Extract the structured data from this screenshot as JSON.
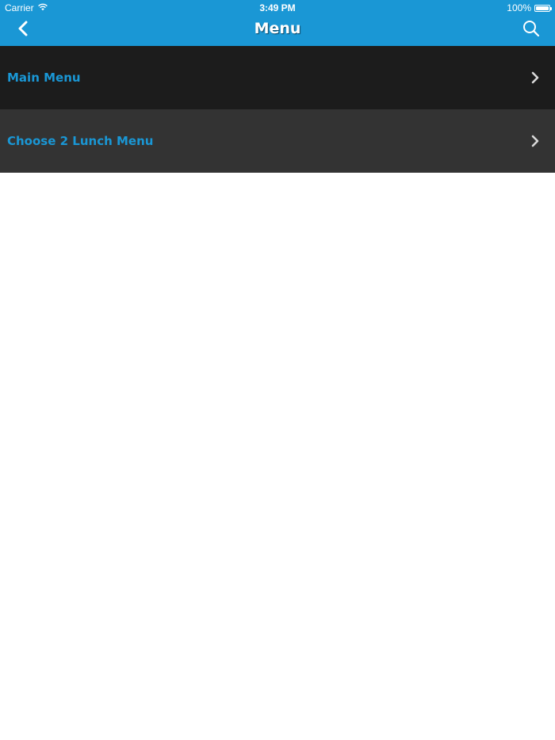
{
  "status_bar": {
    "carrier": "Carrier",
    "time": "3:49 PM",
    "battery_percent": "100%",
    "battery_level": 1.0
  },
  "nav": {
    "title": "Menu",
    "back_icon": "chevron-left-icon",
    "search_icon": "search-icon"
  },
  "menu": {
    "items": [
      {
        "label": "Main Menu",
        "icon": "chevron-right-icon"
      },
      {
        "label": "Choose 2 Lunch Menu",
        "icon": "chevron-right-icon"
      }
    ]
  },
  "colors": {
    "header_bg": "#1a97d5",
    "item_dark_bg": "#1c1c1c",
    "item_mid_bg": "#333333",
    "accent_text": "#1a97d5"
  }
}
